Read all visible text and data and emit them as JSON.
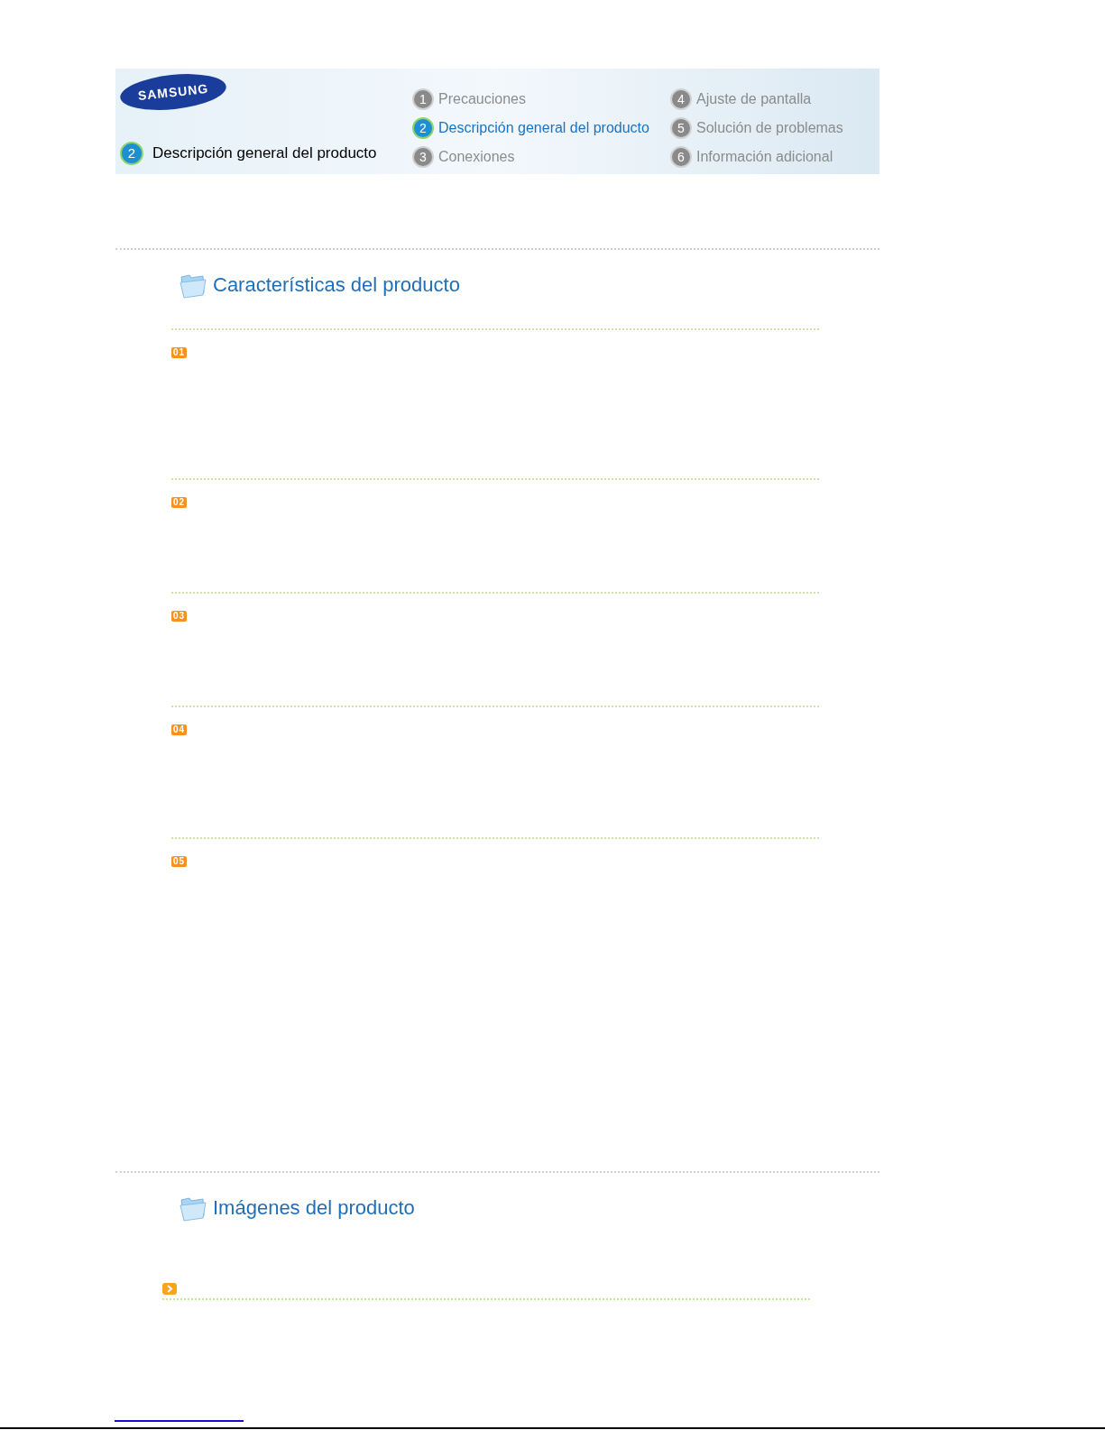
{
  "header": {
    "logo": "SAMSUNG",
    "current_section": {
      "number": "2",
      "title": "Descripción general del producto"
    },
    "menu": [
      {
        "number": "1",
        "label": "Precauciones",
        "selected": false
      },
      {
        "number": "2",
        "label": "Descripción general del producto",
        "selected": true
      },
      {
        "number": "3",
        "label": "Conexiones",
        "selected": false
      },
      {
        "number": "4",
        "label": "Ajuste de pantalla",
        "selected": false
      },
      {
        "number": "5",
        "label": "Solución de problemas",
        "selected": false
      },
      {
        "number": "6",
        "label": "Información adicional",
        "selected": false
      }
    ]
  },
  "sections": [
    {
      "title": "Características del producto",
      "items": [
        {
          "kind": "badge",
          "badge": "01"
        },
        {
          "kind": "badge",
          "badge": "02"
        },
        {
          "kind": "badge",
          "badge": "03"
        },
        {
          "kind": "badge",
          "badge": "04"
        },
        {
          "kind": "badge",
          "badge": "05"
        }
      ]
    },
    {
      "title": "Imágenes del producto",
      "items": [
        {
          "kind": "arrow"
        }
      ]
    }
  ]
}
